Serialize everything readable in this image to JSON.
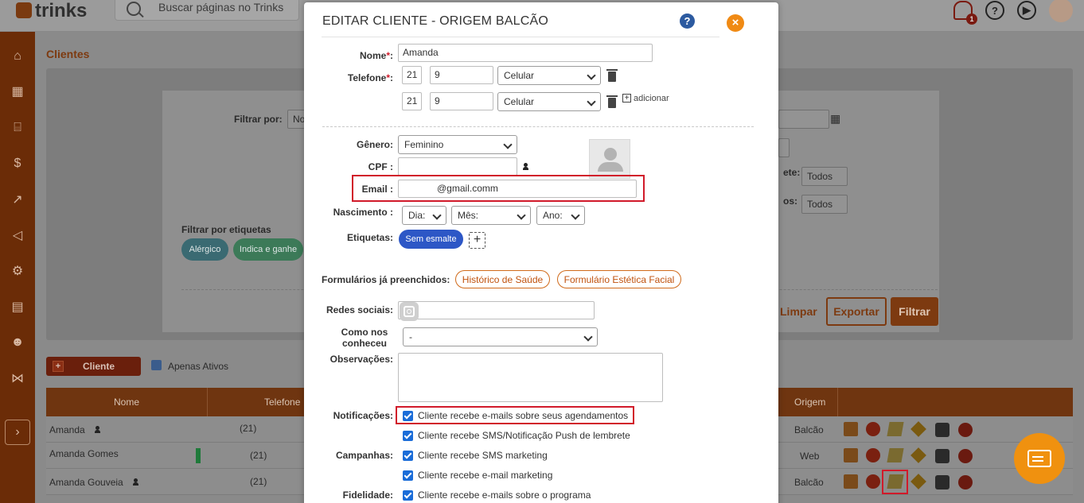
{
  "brand": {
    "logo": "trinks"
  },
  "header": {
    "search_placeholder": "Buscar páginas no Trinks",
    "notif_count": "1",
    "help_symbol": "?"
  },
  "page": {
    "title": "Clientes",
    "filter_by_label": "Filtrar por:",
    "filter_by_value": "No",
    "filter_tags_label": "Filtrar por etiquetas",
    "tags": [
      "Alérgico",
      "Indica e ganhe"
    ],
    "status_label_1": "ete:",
    "status_label_2": "os:",
    "status_value_1": "Todos",
    "status_value_2": "Todos",
    "btn_limpar": "Limpar",
    "btn_exportar": "Exportar",
    "btn_filtrar": "Filtrar",
    "btn_cliente": "Cliente",
    "apenas_ativos": "Apenas Ativos"
  },
  "table": {
    "columns": [
      "Nome",
      "Telefone",
      "Origem"
    ],
    "rows": [
      {
        "name": "Amanda",
        "phone": "(21)",
        "origin": "Balcão"
      },
      {
        "name": "Amanda Gomes",
        "phone": "(21)",
        "origin": "Web"
      },
      {
        "name": "Amanda Gouveia",
        "phone": "(21)",
        "origin": "Balcão"
      }
    ]
  },
  "modal": {
    "title": "EDITAR CLIENTE - ORIGEM BALCÃO",
    "help": "?",
    "close": "×",
    "nome_label": "Nome",
    "nome_value": "Amanda",
    "telefone_label": "Telefone",
    "phones": [
      {
        "ddd": "21",
        "number": "9",
        "type": "Celular"
      },
      {
        "ddd": "21",
        "number": "9",
        "type": "Celular"
      }
    ],
    "adicionar": "adicionar",
    "genero_label": "Gênero:",
    "genero_value": "Feminino",
    "cpf_label": "CPF :",
    "cpf_value": "",
    "email_label": "Email :",
    "email_value": "@gmail.comm",
    "nascimento_label": "Nascimento :",
    "dia": "Dia:",
    "mes": "Mês:",
    "ano": "Ano:",
    "etiquetas_label": "Etiquetas:",
    "etiqueta_tag": "Sem esmalte",
    "tag_add": "+",
    "formularios_label": "Formulários já preenchidos:",
    "formularios": [
      "Histórico de Saúde",
      "Formulário Estética Facial"
    ],
    "redes_label": "Redes sociais:",
    "como_label_1": "Como nos",
    "como_label_2": "conheceu",
    "como_value": "-",
    "observacoes_label": "Observações:",
    "notificacoes_label": "Notificações:",
    "notif_email": "Cliente recebe e-mails sobre seus agendamentos",
    "notif_sms": "Cliente recebe SMS/Notificação Push de lembrete",
    "campanhas_label": "Campanhas:",
    "camp_sms": "Cliente recebe SMS marketing",
    "camp_email": "Cliente recebe e-mail marketing",
    "fidelidade_label": "Fidelidade:",
    "fid_email": "Cliente recebe e-mails sobre o programa"
  }
}
